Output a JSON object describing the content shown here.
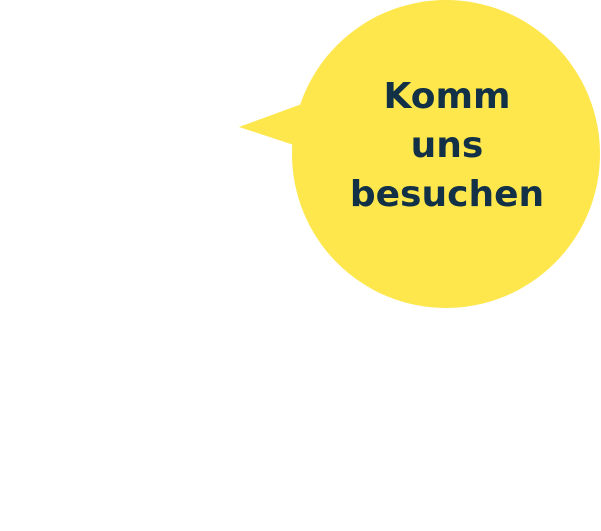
{
  "bubble": {
    "lines": [
      "Komm",
      "uns",
      "besuchen"
    ],
    "fill_color": "#fde74c",
    "text_color": "#123046"
  }
}
